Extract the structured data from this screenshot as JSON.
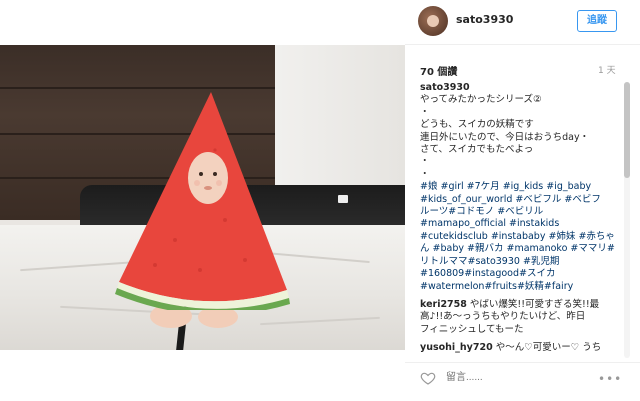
{
  "header": {
    "username": "sato3930",
    "follow_label": "追蹤"
  },
  "stats": {
    "likes": "70 個讚",
    "time": "1 天"
  },
  "caption": {
    "user": "sato3930",
    "lines": [
      "やってみたかったシリーズ②",
      "・",
      "どうも、スイカの妖精です",
      "連日外にいたので、今日はおうちday・",
      "さて、スイカでもたべよっ",
      "・",
      "・"
    ],
    "hashtags": [
      "#娘 #girl #7ケ月 #ig_kids #ig_baby",
      "#kids_of_our_world #ベビフル #ベビフ",
      "ルーツ#コドモノ #ベビリル",
      "#mamapo_official #instakids",
      "#cutekidsclub #instababy #姉妹 #赤ちゃ",
      "ん #baby #親バカ #mamanoko #ママリ#",
      "リトルママ#sato3930 #乳児期",
      "#160809#instagood#スイカ",
      "#watermelon#fruits#妖精#fairy"
    ]
  },
  "comments": [
    {
      "user": "keri2758",
      "lines": [
        " やばい爆笑!!可愛すぎる笑!!最",
        "高♪!!あ〜っうちもやりたいけど、昨日",
        "フィニッシュしてもーた"
      ]
    },
    {
      "user": "yusohi_hy720",
      "lines": [
        " や〜ん♡可愛いー♡ うち"
      ]
    }
  ],
  "footer": {
    "comment_placeholder": "留言......",
    "more_label": "•••"
  },
  "icons": {
    "heart": "heart-icon",
    "more": "more-options-icon",
    "avatar": "avatar"
  },
  "colors": {
    "accent": "#3897f0",
    "hashtag": "#003569",
    "watermelon_flesh": "#e8463d",
    "watermelon_rind": "#6aa84f"
  }
}
